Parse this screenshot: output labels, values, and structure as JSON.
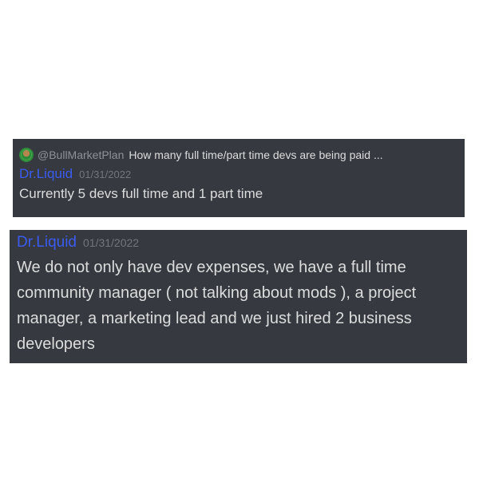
{
  "reply": {
    "username": "@BullMarketPlan",
    "text": "How many full time/part time devs are being paid ...",
    "avatar_icon": "user-avatar-icon"
  },
  "messages": [
    {
      "author": "Dr.Liquid",
      "timestamp": "01/31/2022",
      "text": "Currently 5 devs full time and 1 part time"
    },
    {
      "author": "Dr.Liquid",
      "timestamp": "01/31/2022",
      "text": "We do not only have dev expenses, we have a full time community manager ( not talking about mods ), a project manager, a marketing lead and we just hired 2 business developers"
    }
  ],
  "colors": {
    "card_background": "#36393f",
    "author": "#3b5cf2",
    "message_text": "#dcddde",
    "timestamp": "#72767d",
    "reply_username": "#8e9297"
  }
}
